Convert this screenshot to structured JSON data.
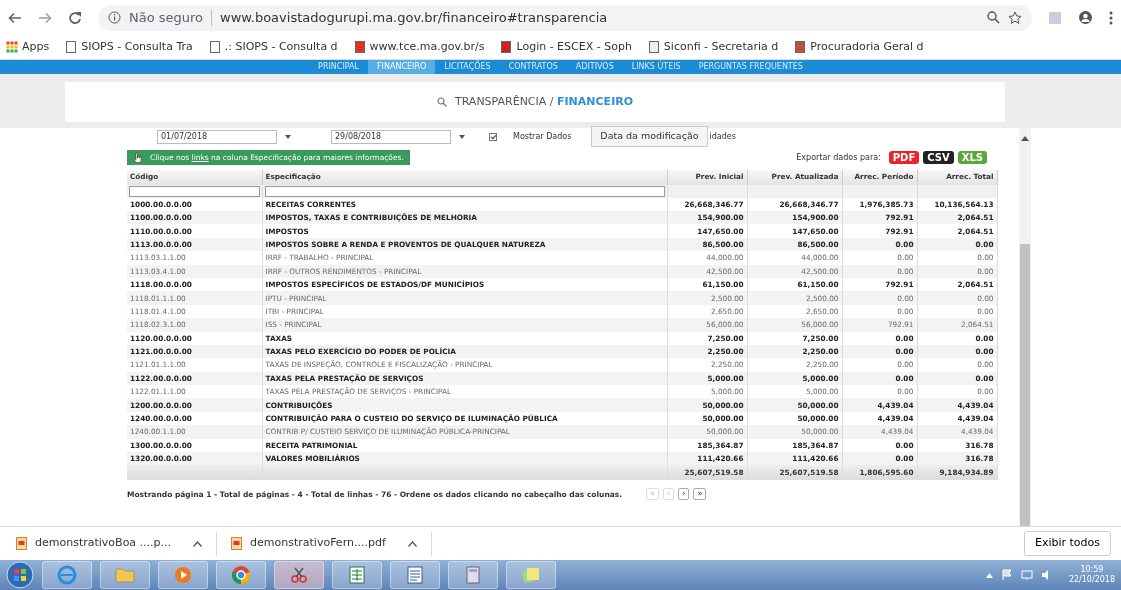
{
  "browser": {
    "security": "Não seguro",
    "url": "www.boavistadogurupi.ma.gov.br/financeiro#transparencia",
    "bookmarks": [
      "Apps",
      "SIOPS - Consulta Tra",
      ".: SIOPS - Consulta d",
      "www.tce.ma.gov.br/s",
      "Login - ESCEX - Soph",
      "Siconfi - Secretaria d",
      "Procuradoria Geral d"
    ]
  },
  "site_nav": [
    {
      "label": "PRINCIPAL",
      "selected": false
    },
    {
      "label": "FINANCEIRO",
      "selected": true
    },
    {
      "label": "LICITAÇÕES",
      "selected": false
    },
    {
      "label": "CONTRATOS",
      "selected": false
    },
    {
      "label": "ADITIVOS",
      "selected": false
    },
    {
      "label": "LINKS ÚTEIS",
      "selected": false
    },
    {
      "label": "PERGUNTAS FREQUENTES",
      "selected": false
    }
  ],
  "breadcrumb": {
    "parent": "TRANSPARÊNCIA /",
    "current": "FINANCEIRO"
  },
  "filters": {
    "date_from": "01/07/2018",
    "date_to": "29/08/2018",
    "checkbox": {
      "label": "Mostrar Dados",
      "checked": true,
      "label_end": "idades"
    },
    "tooltip": "Data da modificação"
  },
  "hint": {
    "before": "Clique nos",
    "link": "links",
    "after": "na coluna Especificação para maiores informações."
  },
  "export": {
    "label": "Exportar dados para:",
    "formats": [
      {
        "label": "PDF",
        "color": "#e8262a"
      },
      {
        "label": "CSV",
        "color": "#222222"
      },
      {
        "label": "XLS",
        "color": "#5aa83a"
      }
    ]
  },
  "table": {
    "columns": [
      "Código",
      "Especificação",
      "Prev. Inicial",
      "Prev. Atualizada",
      "Arrec. Período",
      "Arrec. Total"
    ],
    "rows": [
      {
        "kind": "group",
        "cells": [
          "1000.00.0.0.00",
          "RECEITAS CORRENTES",
          "26,668,346.77",
          "26,668,346.77",
          "1,976,385.73",
          "10,136,564.13"
        ]
      },
      {
        "kind": "group",
        "cells": [
          "1100.00.0.0.00",
          "IMPOSTOS, TAXAS E CONTRIBUIÇÕES DE MELHORIA",
          "154,900.00",
          "154,900.00",
          "792.91",
          "2,064.51"
        ]
      },
      {
        "kind": "group",
        "cells": [
          "1110.00.0.0.00",
          "IMPOSTOS",
          "147,650.00",
          "147,650.00",
          "792.91",
          "2,064.51"
        ]
      },
      {
        "kind": "group",
        "cells": [
          "1113.00.0.0.00",
          "IMPOSTOS SOBRE A RENDA E PROVENTOS DE QUALQUER NATUREZA",
          "86,500.00",
          "86,500.00",
          "0.00",
          "0.00"
        ]
      },
      {
        "kind": "item",
        "cells": [
          "1113.03.1.1.00",
          "IRRF - TRABALHO - PRINCIPAL",
          "44,000.00",
          "44,000.00",
          "0.00",
          "0.00"
        ]
      },
      {
        "kind": "item",
        "cells": [
          "1113.03.4.1.00",
          "IRRF - OUTROS RENDIMENTOS - PRINCIPAL",
          "42,500.00",
          "42,500.00",
          "0.00",
          "0.00"
        ]
      },
      {
        "kind": "group",
        "cells": [
          "1118.00.0.0.00",
          "IMPOSTOS ESPECÍFICOS DE ESTADOS/DF MUNICÍPIOS",
          "61,150.00",
          "61,150.00",
          "792.91",
          "2,064.51"
        ]
      },
      {
        "kind": "item",
        "cells": [
          "1118.01.1.1.00",
          "IPTU - PRINCIPAL",
          "2,500.00",
          "2,500.00",
          "0.00",
          "0.00"
        ]
      },
      {
        "kind": "item",
        "cells": [
          "1118.01.4.1.00",
          "ITBI - PRINCIPAL",
          "2,650.00",
          "2,650.00",
          "0.00",
          "0.00"
        ]
      },
      {
        "kind": "item",
        "cells": [
          "1118.02.3.1.00",
          "ISS - PRINCIPAL",
          "56,000.00",
          "56,000.00",
          "792.91",
          "2,064.51"
        ]
      },
      {
        "kind": "group",
        "cells": [
          "1120.00.0.0.00",
          "TAXAS",
          "7,250.00",
          "7,250.00",
          "0.00",
          "0.00"
        ]
      },
      {
        "kind": "group",
        "cells": [
          "1121.00.0.0.00",
          "TAXAS PELO EXERCÍCIO DO PODER DE POLÍCIA",
          "2,250.00",
          "2,250.00",
          "0.00",
          "0.00"
        ]
      },
      {
        "kind": "item",
        "cells": [
          "1121.01.1.1.00",
          "TAXAS DE INSPEÇÃO, CONTROLE E FISCALIZAÇÃO - PRINCIPAL",
          "2,250.00",
          "2,250.00",
          "0.00",
          "0.00"
        ]
      },
      {
        "kind": "group",
        "cells": [
          "1122.00.0.0.00",
          "TAXAS PELA PRESTAÇÃO DE SERVIÇOS",
          "5,000.00",
          "5,000.00",
          "0.00",
          "0.00"
        ]
      },
      {
        "kind": "item",
        "cells": [
          "1122.01.1.1.00",
          "TAXAS PELA PRESTAÇÃO DE SERVIÇOS - PRINCIPAL",
          "5,000.00",
          "5,000.00",
          "0.00",
          "0.00"
        ]
      },
      {
        "kind": "group",
        "cells": [
          "1200.00.0.0.00",
          "CONTRIBUIÇÕES",
          "50,000.00",
          "50,000.00",
          "4,439.04",
          "4,439.04"
        ]
      },
      {
        "kind": "group",
        "cells": [
          "1240.00.0.0.00",
          "CONTRIBUIÇÃO PARA O CUSTEIO DO SERVIÇO DE ILUMINAÇÃO PÚBLICA",
          "50,000.00",
          "50,000.00",
          "4,439.04",
          "4,439.04"
        ]
      },
      {
        "kind": "item",
        "cells": [
          "1240.00.1.1.00",
          "CONTRIB P/ CUSTEIO SERVIÇO DE ILUMINAÇÃO PÚBLICA-PRINCIPAL",
          "50,000.00",
          "50,000.00",
          "4,439.04",
          "4,439.04"
        ]
      },
      {
        "kind": "group",
        "cells": [
          "1300.00.0.0.00",
          "RECEITA PATRIMONIAL",
          "185,364.87",
          "185,364.87",
          "0.00",
          "316.78"
        ]
      },
      {
        "kind": "group",
        "cells": [
          "1320.00.0.0.00",
          "VALORES MOBILIÁRIOS",
          "111,420.66",
          "111,420.66",
          "0.00",
          "316.78"
        ]
      }
    ],
    "totals": [
      "25,607,519.58",
      "25,607,519.58",
      "1,806,595.60",
      "9,184,934.89"
    ]
  },
  "pager": {
    "summary": "Mostrando página 1 - Total de páginas - 4 - Total de linhas - 76 - Ordene os dados clicando no cabeçalho das colunas.",
    "buttons": [
      {
        "label": "«",
        "disabled": true
      },
      {
        "label": "‹",
        "disabled": true
      },
      {
        "label": "›",
        "disabled": false
      },
      {
        "label": "»",
        "disabled": false
      }
    ]
  },
  "downloads": {
    "files": [
      "demonstrativoBoa ....p...",
      "demonstrativoFern....pdf"
    ],
    "show_all": "Exibir todos"
  },
  "taskbar": {
    "time": "10:59",
    "date": "22/10/2018"
  }
}
